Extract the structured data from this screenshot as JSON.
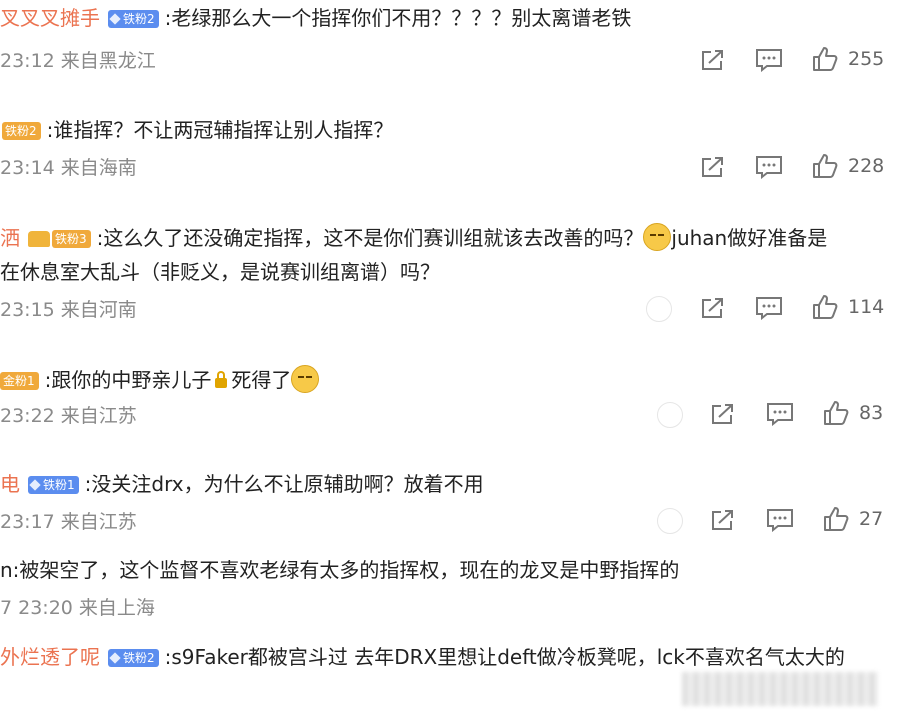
{
  "comments": [
    {
      "user": "叉叉叉摊手",
      "badge": "铁粉2",
      "text": ":老绿那么大一个指挥你们不用？？？？别太离谱老铁",
      "meta": "23:12 来自黑龙江",
      "likes": "255"
    },
    {
      "user": "",
      "badge": "铁粉2",
      "text": ":谁指挥？不让两冠辅指挥让别人指挥？",
      "meta": "23:14 来自海南",
      "likes": "228"
    },
    {
      "user": "洒",
      "badge": "铁粉3",
      "text": ":这么久了还没确定指挥，这不是你们赛训组就该去改善的吗？",
      "text_after_emoji": "juhan做好准备是",
      "text_line2": "在休息室大乱斗（非贬义，是说赛训组离谱）吗？",
      "meta": "23:15 来自河南",
      "likes": "114"
    },
    {
      "user": "",
      "badge": "金粉1",
      "text": ":跟你的中野亲儿子",
      "text_after_lock": "死得了",
      "meta": "23:22 来自江苏",
      "likes": "83"
    },
    {
      "user": "电",
      "badge": "铁粉1",
      "text": ":没关注drx，为什么不让原辅助啊？放着不用",
      "meta": "23:17 来自江苏",
      "likes": "27"
    },
    {
      "user": "",
      "text": "n:被架空了，这个监督不喜欢老绿有太多的指挥权，现在的龙叉是中野指挥的",
      "meta": "7 23:20 来自上海"
    },
    {
      "user": "外烂透了呢",
      "badge": "铁粉2",
      "text": ":s9Faker都被宫斗过 去年DRX里想让deft做冷板凳呢，lck不喜欢名气太大的"
    }
  ],
  "icons": {
    "share": "share-icon",
    "comment": "comment-icon",
    "like": "thumbs-up-icon"
  },
  "colors": {
    "username": "#eb7350",
    "badge_blue": "#5b8def",
    "badge_gold": "#f0a93b",
    "meta": "#8a8a8a"
  }
}
